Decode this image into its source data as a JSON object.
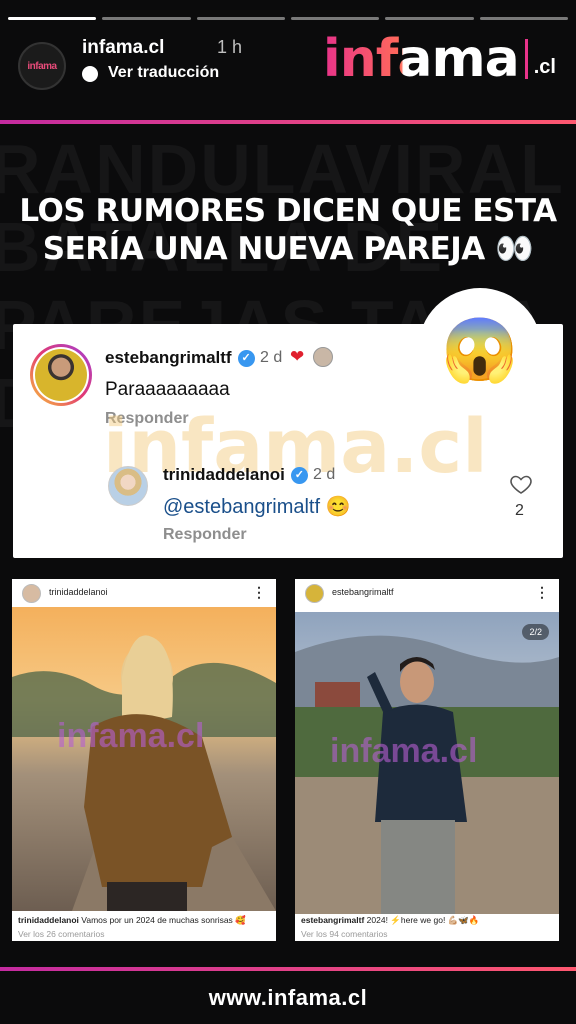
{
  "story": {
    "account": "infama.cl",
    "time": "1 h",
    "translate": "Ver traducción",
    "segments": 6,
    "active_segment": 1
  },
  "brand": {
    "word": "infama",
    "tld": ".cl",
    "mini_logo": "infama",
    "colors": {
      "accent": "#e8338a",
      "accent2": "#ff5870"
    }
  },
  "headline": {
    "line1": "LOS RUMORES DICEN QUE ESTA",
    "line2": "SERÍA UNA NUEVA PAREJA 👀"
  },
  "background_text": "RANDULAVIRAL BATALLA DE PAREJAS TARA DULAVIRAL",
  "emoji_reaction": "😱",
  "comments": {
    "first": {
      "user": "estebangrimaltf",
      "time": "2 d",
      "text": "Paraaaaaaaaa",
      "reply_label": "Responder"
    },
    "second": {
      "user": "trinidaddelanoi",
      "time": "2 d",
      "text": "@estebangrimaltf 😊",
      "reply_label": "Responder",
      "likes": "2"
    },
    "watermark": "infama.cl"
  },
  "posts": [
    {
      "user": "trinidaddelanoi",
      "caption_user": "trinidaddelanoi",
      "caption": "Vamos por un 2024 de muchas sonrisas 🥰",
      "comments": "Ver los 26 comentarios",
      "watermark": "infama.cl"
    },
    {
      "user": "estebangrimaltf",
      "caption_user": "estebangrimaltf",
      "caption": "2024! ⚡here we go! 💪🏼🦋🔥",
      "comments": "Ver los 94 comentarios",
      "counter": "2/2",
      "watermark": "infama.cl"
    }
  ],
  "footer": {
    "url": "www.infama.cl"
  }
}
